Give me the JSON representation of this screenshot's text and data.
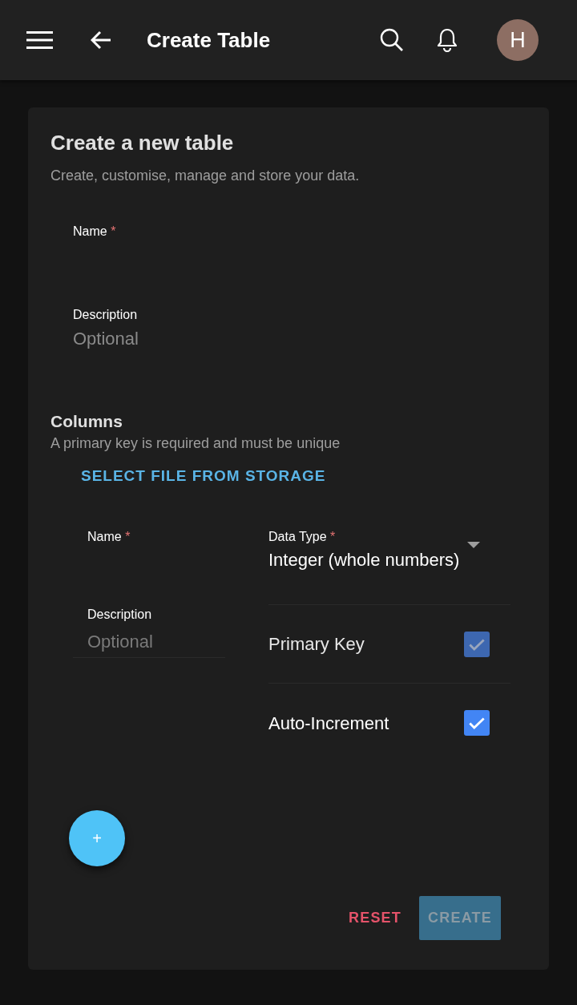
{
  "app_bar": {
    "title": "Create Table",
    "avatar": "H"
  },
  "card": {
    "title": "Create a new table",
    "subtitle": "Create, customise, manage and store your data.",
    "fields": [
      {
        "label": "Name",
        "required_mark": "*"
      },
      {
        "label": "Description",
        "placeholder": "Optional"
      }
    ],
    "columns_section": {
      "title": "Columns",
      "subtitle": "A primary key is required and must be unique",
      "select_file_button": "SELECT FILE FROM STORAGE",
      "column": {
        "name_label": "Name",
        "name_required_mark": "*",
        "description_label": "Description",
        "description_placeholder": "Optional",
        "data_type_label": "Data Type",
        "data_type_required_mark": "*",
        "data_type_value": "Integer (whole numbers)",
        "options": [
          {
            "label": "Primary Key",
            "checked": true,
            "disabled": true
          },
          {
            "label": "Auto-Increment",
            "checked": true,
            "disabled": false
          }
        ]
      }
    },
    "add_button": "+",
    "actions": {
      "reset": "RESET",
      "create": "CREATE",
      "create_disabled": true
    }
  }
}
